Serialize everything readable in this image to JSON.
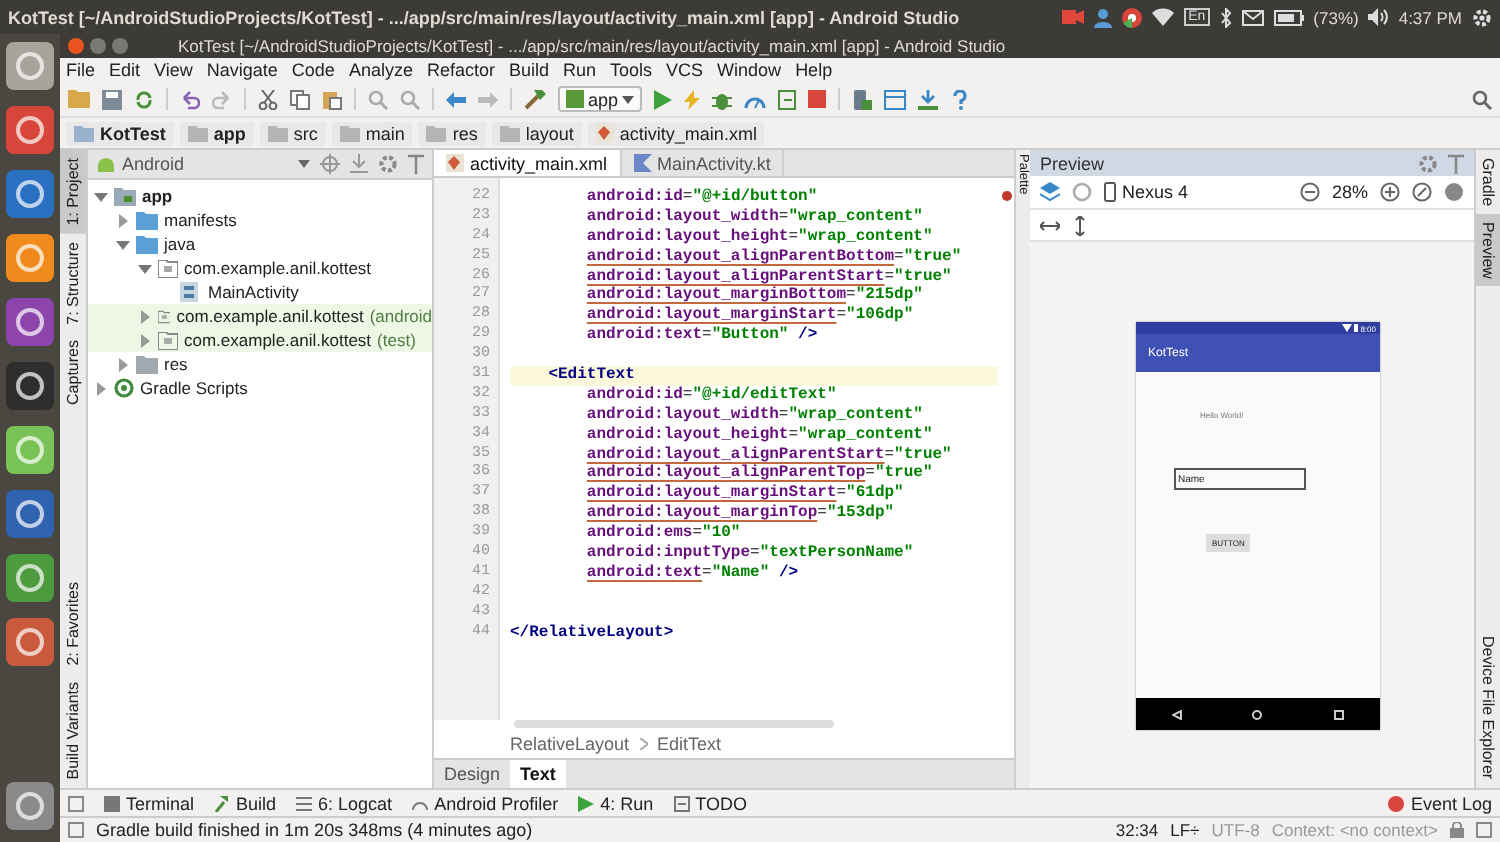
{
  "system_bar": {
    "title": "KotTest [~/AndroidStudioProjects/KotTest] - .../app/src/main/res/layout/activity_main.xml [app] - Android Studio",
    "keyboard": "En",
    "battery": "(73%)",
    "time": "4:37 PM"
  },
  "launcher": [
    {
      "color": "#a8a39b"
    },
    {
      "color": "#d8453a"
    },
    {
      "color": "#2a6fc0"
    },
    {
      "color": "#f08a1c"
    },
    {
      "color": "#8e44ad"
    },
    {
      "color": "#2e2e2e"
    },
    {
      "color": "#78c257"
    },
    {
      "color": "#2f62b0"
    },
    {
      "color": "#4e9a3e"
    },
    {
      "color": "#c95a3c"
    },
    {
      "color": "#8a8a8a"
    }
  ],
  "window": {
    "title": "KotTest [~/AndroidStudioProjects/KotTest] - .../app/src/main/res/layout/activity_main.xml [app] - Android Studio"
  },
  "menu": [
    "File",
    "Edit",
    "View",
    "Navigate",
    "Code",
    "Analyze",
    "Refactor",
    "Build",
    "Run",
    "Tools",
    "VCS",
    "Window",
    "Help"
  ],
  "toolbar": {
    "run_config": "app"
  },
  "nav_bar": [
    "KotTest",
    "app",
    "src",
    "main",
    "res",
    "layout",
    "activity_main.xml"
  ],
  "left_tool_strip": [
    {
      "label": "1: Project",
      "selected": true,
      "kind": "top"
    },
    {
      "label": "7: Structure",
      "selected": false,
      "kind": "top"
    },
    {
      "label": "Captures",
      "selected": false,
      "kind": "top"
    },
    {
      "label": "2: Favorites",
      "selected": false,
      "kind": "bottom"
    },
    {
      "label": "Build Variants",
      "selected": false,
      "kind": "bottom"
    }
  ],
  "project": {
    "view": "Android",
    "tree": [
      {
        "label": "app",
        "kind": "module",
        "expanded": true,
        "children": [
          {
            "label": "manifests",
            "kind": "folder",
            "expanded": false
          },
          {
            "label": "java",
            "kind": "folder",
            "expanded": true,
            "children": [
              {
                "label": "com.example.anil.kottest",
                "kind": "package",
                "expanded": true,
                "children": [
                  {
                    "label": "MainActivity",
                    "kind": "class"
                  }
                ]
              },
              {
                "label": "com.example.anil.kottest",
                "note": "(android",
                "kind": "test_package",
                "expanded": false
              },
              {
                "label": "com.example.anil.kottest",
                "note": "(test)",
                "kind": "test_package",
                "expanded": false
              }
            ]
          },
          {
            "label": "res",
            "kind": "res",
            "expanded": false
          }
        ]
      },
      {
        "label": "Gradle Scripts",
        "kind": "gradle",
        "expanded": false
      }
    ]
  },
  "editor": {
    "tabs": [
      {
        "label": "activity_main.xml",
        "selected": true
      },
      {
        "label": "MainActivity.kt",
        "selected": false
      }
    ],
    "lines": [
      {
        "number": "22",
        "text": "        android:id=\"@+id/button\"",
        "warning": false,
        "current": false
      },
      {
        "number": "23",
        "text": "        android:layout_width=\"wrap_content\"",
        "warning": false,
        "current": false
      },
      {
        "number": "24",
        "text": "        android:layout_height=\"wrap_content\"",
        "warning": false,
        "current": false
      },
      {
        "number": "25",
        "text": "        android:layout_alignParentBottom=\"true\"",
        "warning": true,
        "current": false
      },
      {
        "number": "26",
        "text": "        android:layout_alignParentStart=\"true\"",
        "warning": true,
        "current": false
      },
      {
        "number": "27",
        "text": "        android:layout_marginBottom=\"215dp\"",
        "warning": true,
        "current": false
      },
      {
        "number": "28",
        "text": "        android:layout_marginStart=\"106dp\"",
        "warning": true,
        "current": false
      },
      {
        "number": "29",
        "text": "        android:text=\"Button\" />",
        "warning": false,
        "current": false
      },
      {
        "number": "30",
        "current": false
      },
      {
        "number": "31",
        "text": "    <EditText",
        "warning": false,
        "current": true
      },
      {
        "number": "32",
        "text": "        android:id=\"@+id/editText\"",
        "warning": false,
        "current": false
      },
      {
        "number": "33",
        "text": "        android:layout_width=\"wrap_content\"",
        "warning": false,
        "current": false
      },
      {
        "number": "34",
        "text": "        android:layout_height=\"wrap_content\"",
        "warning": false,
        "current": false
      },
      {
        "number": "35",
        "text": "        android:layout_alignParentStart=\"true\"",
        "warning": true,
        "current": false
      },
      {
        "number": "36",
        "text": "        android:layout_alignParentTop=\"true\"",
        "warning": true,
        "current": false
      },
      {
        "number": "37",
        "text": "        android:layout_marginStart=\"61dp\"",
        "warning": true,
        "current": false
      },
      {
        "number": "38",
        "text": "        android:layout_marginTop=\"153dp\"",
        "warning": true,
        "current": false
      },
      {
        "number": "39",
        "text": "        android:ems=\"10\"",
        "warning": false,
        "current": false
      },
      {
        "number": "40",
        "text": "        android:inputType=\"textPersonName\"",
        "warning": false,
        "current": false
      },
      {
        "number": "41",
        "text": "        android:text=\"Name\" />",
        "warning": true,
        "current": false
      },
      {
        "number": "42",
        "current": false
      },
      {
        "number": "43",
        "current": false
      },
      {
        "number": "44",
        "text": "</RelativeLayout>",
        "current": false
      }
    ],
    "breadcrumb": [
      "RelativeLayout",
      "EditText"
    ],
    "view_tabs": [
      {
        "label": "Design",
        "selected": false
      },
      {
        "label": "Text",
        "selected": true
      }
    ]
  },
  "palette_strip": "Palette",
  "preview": {
    "title": "Preview",
    "device": "Nexus 4",
    "zoom": "28%",
    "phone": {
      "status_time": "8:00",
      "app_title": "KotTest",
      "text_view": "Hello World!",
      "edit_text": "Name",
      "button": "BUTTON"
    }
  },
  "right_tool_strip": [
    {
      "label": "Gradle",
      "selected": false,
      "kind": "top"
    },
    {
      "label": "Preview",
      "selected": true,
      "kind": "top"
    },
    {
      "label": "Device File Explorer",
      "selected": false,
      "kind": "bottom"
    }
  ],
  "tool_windows": [
    {
      "label": "Terminal",
      "kind": "terminal"
    },
    {
      "label": "Build",
      "kind": "build"
    },
    {
      "label": "6: Logcat",
      "kind": "logcat"
    },
    {
      "label": "Android Profiler",
      "kind": "profiler"
    },
    {
      "label": "4: Run",
      "kind": "run"
    },
    {
      "label": "TODO",
      "kind": "todo"
    }
  ],
  "event_log": "Event Log",
  "status_bar": {
    "message": "Gradle build finished in 1m 20s 348ms (4 minutes ago)",
    "position": "32:34",
    "line_separator": "LF÷",
    "encoding": "UTF-8",
    "context": "Context: <no context>"
  }
}
